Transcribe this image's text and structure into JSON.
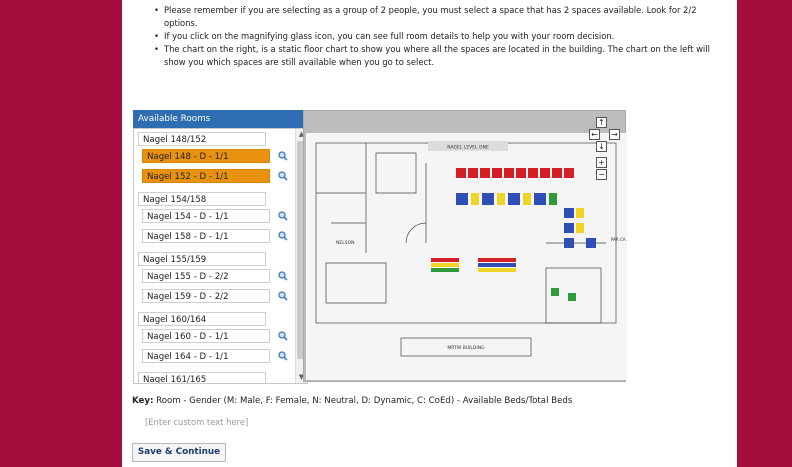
{
  "instructions": [
    "Please remember if you are selecting as a group of 2 people, you must select a space that has 2 spaces available.  Look for 2/2 options.",
    "If you click on the magnifying glass icon, you can see full room details to help you with your room decision.",
    "The chart on the right, is a static floor chart to show you where all the spaces are located in the building.  The chart on the left will show you which spaces are still available when you go to select."
  ],
  "rooms_panel": {
    "title": "Available Rooms",
    "groups": [
      {
        "label": "Nagel 148/152",
        "rooms": [
          {
            "label": "Nagel 148 - D - 1/1",
            "selected": true
          },
          {
            "label": "Nagel 152 - D - 1/1",
            "selected": true
          }
        ]
      },
      {
        "label": "Nagel 154/158",
        "rooms": [
          {
            "label": "Nagel 154 - D - 1/1",
            "selected": false
          },
          {
            "label": "Nagel 158 - D - 1/1",
            "selected": false
          }
        ]
      },
      {
        "label": "Nagel 155/159",
        "rooms": [
          {
            "label": "Nagel 155 - D - 2/2",
            "selected": false
          },
          {
            "label": "Nagel 159 - D - 2/2",
            "selected": false
          }
        ]
      },
      {
        "label": "Nagel 160/164",
        "rooms": [
          {
            "label": "Nagel 160 - D - 1/1",
            "selected": false
          },
          {
            "label": "Nagel 164 - D - 1/1",
            "selected": false
          }
        ]
      },
      {
        "label": "Nagel 161/165",
        "rooms": []
      }
    ]
  },
  "floor_chart": {
    "title": "NAGEL LEVEL ONE",
    "bottom_label": "MRTW BUILDING",
    "left_label": "NELSON",
    "right_label": "PAR CA",
    "nav_labels": {
      "up": "↑",
      "left": "←",
      "right": "→",
      "down": "↓",
      "zoom_in": "+",
      "zoom_out": "−"
    }
  },
  "key": {
    "label": "Key:",
    "text": "Room - Gender (M: Male, F: Female, N: Neutral, D: Dynamic, C: CoEd) - Available Beds/Total Beds"
  },
  "custom_text": "[Enter custom text here]",
  "save_button": "Save & Continue",
  "colors": {
    "background": "#a50d3c",
    "header": "#2f6db3",
    "selected": "#e8920f"
  }
}
